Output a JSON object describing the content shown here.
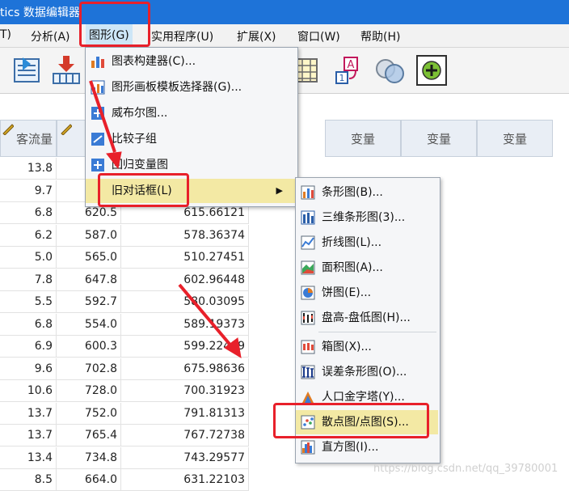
{
  "title_bar": {
    "text": "tics 数据编辑器"
  },
  "menubar": {
    "items": [
      "T)",
      "分析(A)",
      "图形(G)",
      "实用程序(U)",
      "扩展(X)",
      "窗口(W)",
      "帮助(H)"
    ]
  },
  "grid": {
    "headers": [
      "客流量",
      "",
      "变量",
      "变量",
      "变量"
    ],
    "rows": [
      [
        "13.8",
        "",
        ""
      ],
      [
        "9.7",
        "",
        ""
      ],
      [
        "6.8",
        "620.5",
        "615.66121"
      ],
      [
        "6.2",
        "587.0",
        "578.36374"
      ],
      [
        "5.0",
        "565.0",
        "510.27451"
      ],
      [
        "7.8",
        "647.8",
        "602.96448"
      ],
      [
        "5.5",
        "592.7",
        "580.03095"
      ],
      [
        "6.8",
        "554.0",
        "589.19373"
      ],
      [
        "6.9",
        "600.3",
        "599.22409"
      ],
      [
        "9.6",
        "702.8",
        "675.98636"
      ],
      [
        "10.6",
        "728.0",
        "700.31923"
      ],
      [
        "13.7",
        "752.0",
        "791.81313"
      ],
      [
        "13.7",
        "765.4",
        "767.72738"
      ],
      [
        "13.4",
        "734.8",
        "743.29577"
      ],
      [
        "8.5",
        "664.0",
        "631.22103"
      ]
    ]
  },
  "graphs_menu": {
    "items": [
      {
        "label": "图表构建器(C)...",
        "icon": "chart-builder-icon"
      },
      {
        "label": "图形画板模板选择器(G)...",
        "icon": "template-chooser-icon"
      },
      {
        "label": "威布尔图...",
        "icon": "weibull-icon"
      },
      {
        "label": "比较子组",
        "icon": "compare-subgroups-icon"
      },
      {
        "label": "回归变量图",
        "icon": "regression-plot-icon"
      },
      {
        "label": "旧对话框(L)",
        "icon": ""
      }
    ]
  },
  "legacy_submenu": {
    "items": [
      {
        "label": "条形图(B)...",
        "icon": "bar-chart-icon"
      },
      {
        "label": "三维条形图(3)...",
        "icon": "3d-bar-icon"
      },
      {
        "label": "折线图(L)...",
        "icon": "line-chart-icon"
      },
      {
        "label": "面积图(A)...",
        "icon": "area-chart-icon"
      },
      {
        "label": "饼图(E)...",
        "icon": "pie-chart-icon"
      },
      {
        "label": "盘高-盘低图(H)...",
        "icon": "high-low-icon"
      },
      {
        "label": "箱图(X)...",
        "icon": "boxplot-icon"
      },
      {
        "label": "误差条形图(O)...",
        "icon": "error-bar-icon"
      },
      {
        "label": "人口金字塔(Y)...",
        "icon": "pyramid-icon"
      },
      {
        "label": "散点图/点图(S)...",
        "icon": "scatter-icon"
      },
      {
        "label": "直方图(I)...",
        "icon": "histogram-icon"
      }
    ]
  },
  "watermark": "https://blog.csdn.net/qq_39780001",
  "colors": {
    "title_bar": "#1e73d8",
    "annotation": "#e8202a",
    "highlight": "#f3e9a4"
  }
}
